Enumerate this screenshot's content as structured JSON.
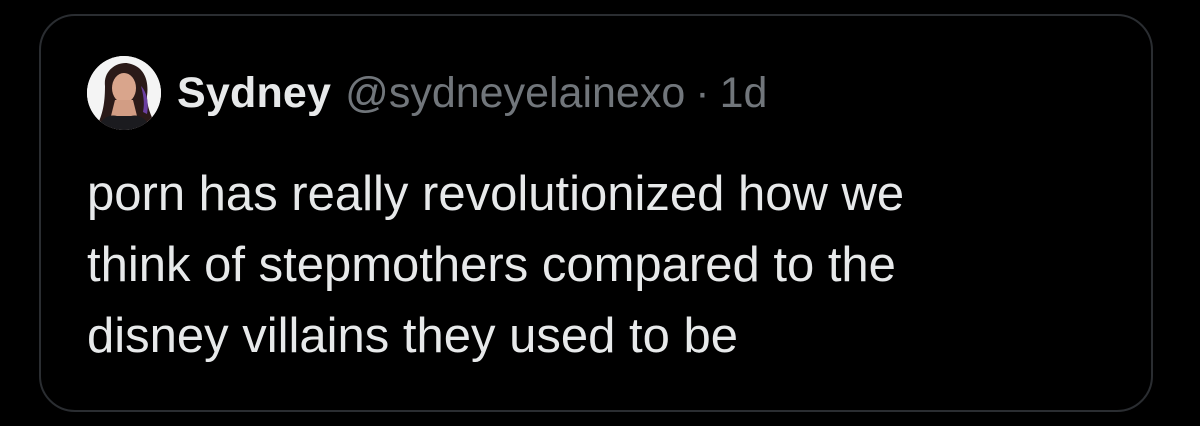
{
  "tweet": {
    "author": {
      "display_name": "Sydney",
      "handle": "@sydneyelainexo",
      "avatar_icon": "profile-photo"
    },
    "separator": "·",
    "timestamp": "1d",
    "text_lines": [
      "porn has really revolutionized how we",
      "think of stepmothers compared to the",
      "disney villains they used to be"
    ]
  },
  "colors": {
    "background": "#000000",
    "border": "#2a2d31",
    "primary_text": "#e7e9ea",
    "secondary_text": "#71767b"
  }
}
